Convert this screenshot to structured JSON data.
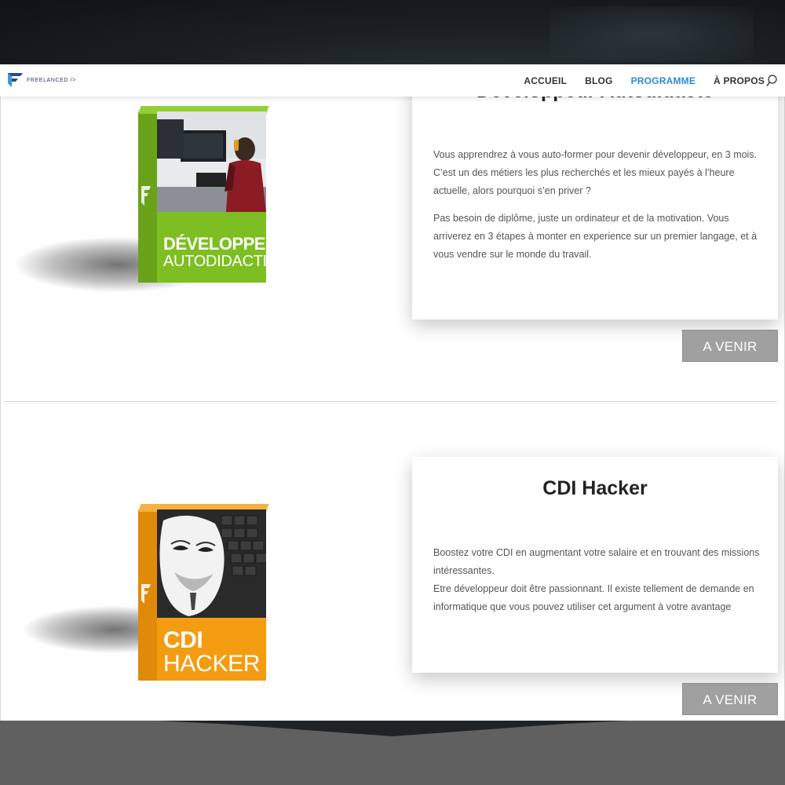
{
  "site": {
    "logo_text": "FREELANCED />"
  },
  "nav": {
    "items": [
      {
        "label": "ACCUEIL"
      },
      {
        "label": "BLOG"
      },
      {
        "label": "PROGRAMME"
      },
      {
        "label": "À PROPOS"
      }
    ],
    "active": "PROGRAMME",
    "search_icon": "search-icon"
  },
  "colors": {
    "accent": "#2b8ad4",
    "green_box": "#7dbf22",
    "orange_box": "#f39c12",
    "button": "#a0a0a0",
    "footer": "#606060"
  },
  "programs": [
    {
      "title": "Développeur Autodidacte",
      "box_line1": "DÉVELOPPEUR",
      "box_line2": "AUTODIDACTE",
      "paragraphs": [
        "Vous apprendrez à vous auto-former pour devenir développeur, en 3 mois. C’est un des métiers les plus recherchés et les mieux payés à l’heure actuelle, alors pourquoi s’en priver ?",
        "Pas besoin de diplôme, juste un ordinateur et de la motivation. Vous arriverez en 3 étapes à monter en experience sur un premier langage, et à vous vendre sur le monde du travail."
      ],
      "button_label": "A VENIR"
    },
    {
      "title": "CDI Hacker",
      "box_line1": "CDI",
      "box_line2": "HACKER",
      "paragraphs": [
        "Boostez votre CDI en augmentant votre salaire et en trouvant des missions intéressantes.",
        "Etre développeur doit être passionnant. Il existe tellement de demande en informatique que vous pouvez utiliser cet argument à votre avantage"
      ],
      "button_label": "A VENIR"
    }
  ]
}
